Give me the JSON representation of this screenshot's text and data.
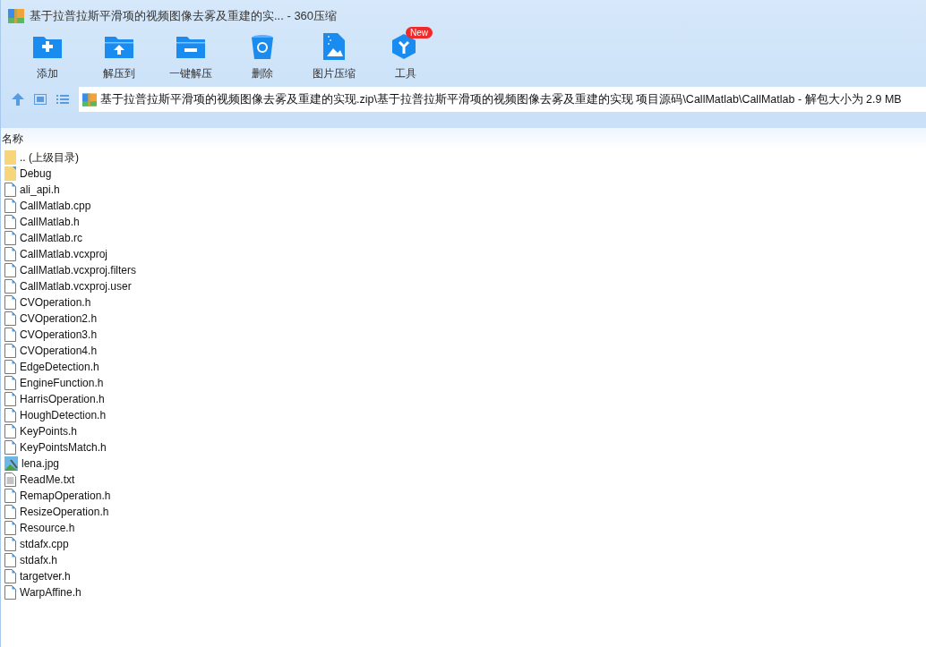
{
  "window": {
    "title": "基于拉普拉斯平滑项的视频图像去雾及重建的实... - 360压缩"
  },
  "toolbar": [
    {
      "label": "添加",
      "kind": "add"
    },
    {
      "label": "解压到",
      "kind": "extract"
    },
    {
      "label": "一键解压",
      "kind": "oneclick"
    },
    {
      "label": "删除",
      "kind": "delete"
    },
    {
      "label": "图片压缩",
      "kind": "image"
    },
    {
      "label": "工具",
      "kind": "tools",
      "badge": "New"
    }
  ],
  "address": {
    "path": "基于拉普拉斯平滑项的视频图像去雾及重建的实现.zip\\基于拉普拉斯平滑项的视频图像去雾及重建的实现 项目源码\\CallMatlab\\CallMatlab - 解包大小为 2.9 MB"
  },
  "table": {
    "columns": [
      "名称"
    ],
    "rows": [
      {
        "name": ".. (上级目录)",
        "kind": "parent"
      },
      {
        "name": "Debug",
        "kind": "folder"
      },
      {
        "name": "ali_api.h",
        "kind": "file"
      },
      {
        "name": "CallMatlab.cpp",
        "kind": "file"
      },
      {
        "name": "CallMatlab.h",
        "kind": "file"
      },
      {
        "name": "CallMatlab.rc",
        "kind": "file"
      },
      {
        "name": "CallMatlab.vcxproj",
        "kind": "file"
      },
      {
        "name": "CallMatlab.vcxproj.filters",
        "kind": "file"
      },
      {
        "name": "CallMatlab.vcxproj.user",
        "kind": "file"
      },
      {
        "name": "CVOperation.h",
        "kind": "file"
      },
      {
        "name": "CVOperation2.h",
        "kind": "file"
      },
      {
        "name": "CVOperation3.h",
        "kind": "file"
      },
      {
        "name": "CVOperation4.h",
        "kind": "file"
      },
      {
        "name": "EdgeDetection.h",
        "kind": "file"
      },
      {
        "name": "EngineFunction.h",
        "kind": "file"
      },
      {
        "name": "HarrisOperation.h",
        "kind": "file"
      },
      {
        "name": "HoughDetection.h",
        "kind": "file"
      },
      {
        "name": "KeyPoints.h",
        "kind": "file"
      },
      {
        "name": "KeyPointsMatch.h",
        "kind": "file"
      },
      {
        "name": "lena.jpg",
        "kind": "image"
      },
      {
        "name": "ReadMe.txt",
        "kind": "text"
      },
      {
        "name": "RemapOperation.h",
        "kind": "file"
      },
      {
        "name": "ResizeOperation.h",
        "kind": "file"
      },
      {
        "name": "Resource.h",
        "kind": "file"
      },
      {
        "name": "stdafx.cpp",
        "kind": "file"
      },
      {
        "name": "stdafx.h",
        "kind": "file"
      },
      {
        "name": "targetver.h",
        "kind": "file"
      },
      {
        "name": "WarpAffine.h",
        "kind": "file"
      }
    ]
  }
}
